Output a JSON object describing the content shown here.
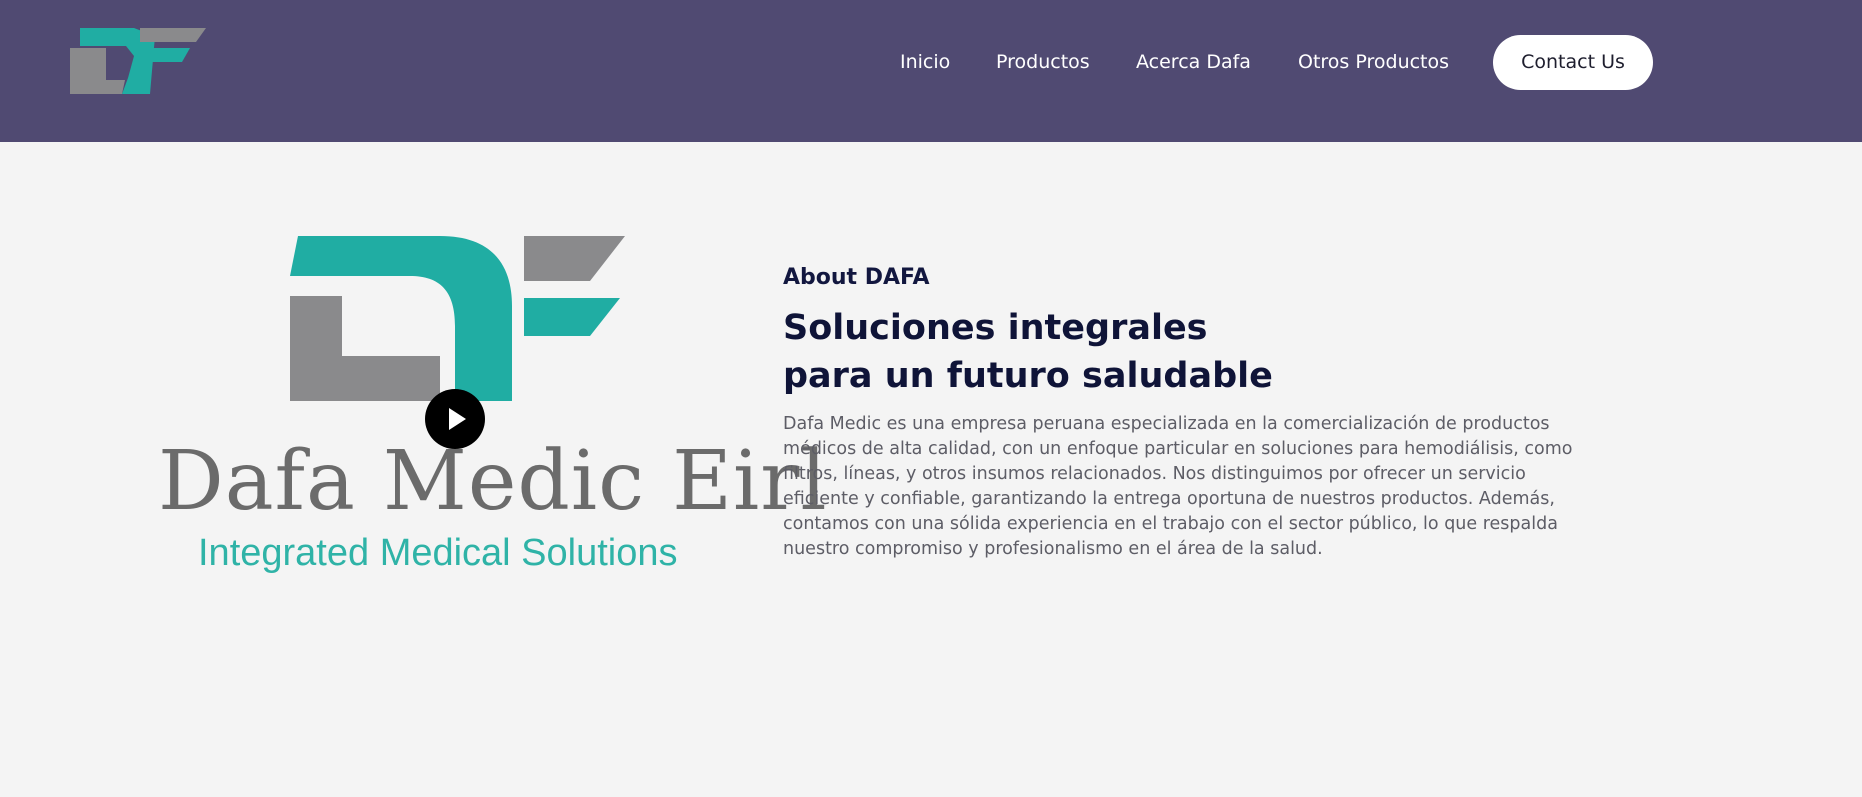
{
  "header": {
    "logo_icon": "df-logo-icon",
    "nav": [
      {
        "label": "Inicio"
      },
      {
        "label": "Productos"
      },
      {
        "label": "Acerca Dafa"
      },
      {
        "label": "Otros Productos"
      }
    ],
    "contact_label": "Contact Us"
  },
  "about": {
    "brand_name": "Dafa Medic Eirl",
    "brand_tagline": "Integrated Medical Solutions",
    "play_icon": "play-icon",
    "eyebrow": "About DAFA",
    "title": "Soluciones integrales para un futuro saludable",
    "description": "Dafa Medic es una empresa peruana especializada en la comercialización de productos médicos de alta calidad, con un enfoque particular en soluciones para hemodiálisis, como filtros, líneas, y otros insumos relacionados. Nos distinguimos por ofrecer un servicio eficiente y confiable, garantizando la entrega oportuna de nuestros productos. Además, contamos con una sólida experiencia en el trabajo con el sector público, lo que respalda nuestro compromiso y profesionalismo en el área de la salud."
  },
  "colors": {
    "header_bg": "#504a72",
    "teal": "#20ada3",
    "gray": "#8a8a8c",
    "page_bg": "#f4f4f4",
    "heading": "#0f1438"
  }
}
